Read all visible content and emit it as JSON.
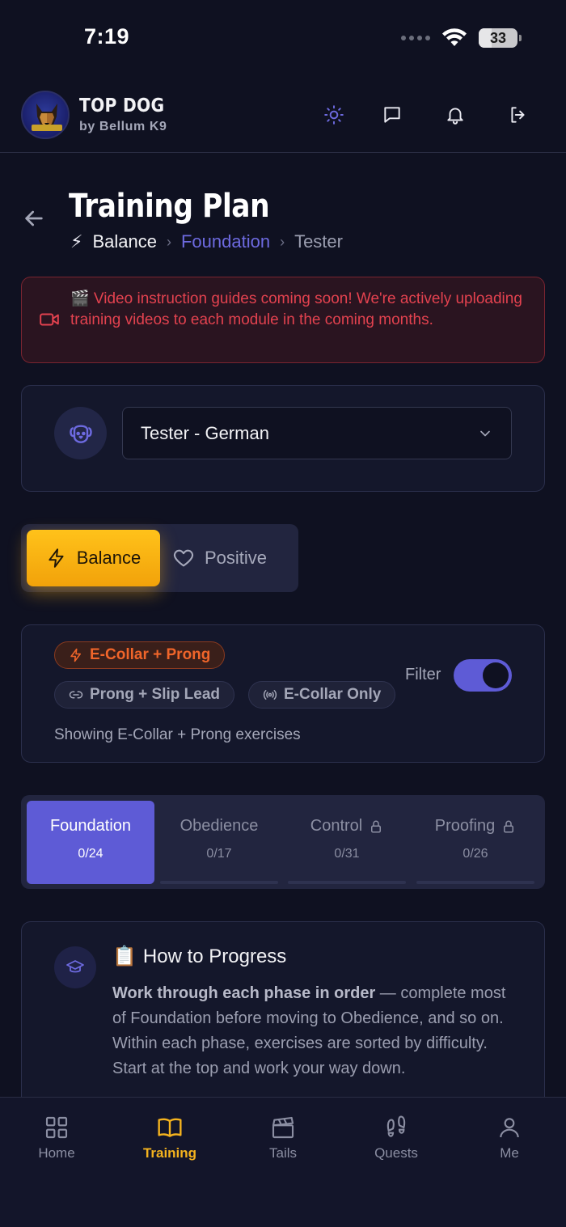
{
  "status_bar": {
    "time": "7:19",
    "battery": "33"
  },
  "header": {
    "brand_title": "TOP DOG",
    "brand_subtitle": "by Bellum K9",
    "icons": [
      "sun-icon",
      "chat-icon",
      "bell-icon",
      "logout-icon"
    ]
  },
  "page": {
    "title": "Training Plan",
    "breadcrumb": {
      "icon": "⚡",
      "method": "Balance",
      "phase": "Foundation",
      "dog": "Tester"
    }
  },
  "banner": {
    "text": "🎬 Video instruction guides coming soon! We're actively uploading training videos to each module in the coming months."
  },
  "dog_select": {
    "value": "Tester - German"
  },
  "method_toggle": {
    "options": [
      {
        "label": "Balance",
        "icon": "bolt-icon",
        "selected": true
      },
      {
        "label": "Positive",
        "icon": "heart-icon",
        "selected": false
      }
    ]
  },
  "equipment": {
    "chips": [
      {
        "label": "E-Collar + Prong",
        "icon": "bolt-icon",
        "active": true
      },
      {
        "label": "Prong + Slip Lead",
        "icon": "link-icon",
        "active": false
      },
      {
        "label": "E-Collar Only",
        "icon": "signal-icon",
        "active": false
      }
    ],
    "filter_label": "Filter",
    "filter_on": true,
    "note": "Showing E-Collar + Prong exercises"
  },
  "phases": [
    {
      "name": "Foundation",
      "count": "0/24",
      "locked": false,
      "active": true
    },
    {
      "name": "Obedience",
      "count": "0/17",
      "locked": false,
      "active": false
    },
    {
      "name": "Control",
      "count": "0/31",
      "locked": true,
      "active": false
    },
    {
      "name": "Proofing",
      "count": "0/26",
      "locked": true,
      "active": false
    }
  ],
  "progress_card": {
    "title_emoji": "📋",
    "title": "How to Progress",
    "body_bold": "Work through each phase in order",
    "body_rest": " — complete most of Foundation before moving to Obedience, and so on. Within each phase, exercises are sorted by difficulty. Start at the top and work your way down."
  },
  "nav": {
    "items": [
      {
        "label": "Home",
        "icon": "grid-icon"
      },
      {
        "label": "Training",
        "icon": "book-icon",
        "active": true
      },
      {
        "label": "Tails",
        "icon": "clapper-icon"
      },
      {
        "label": "Quests",
        "icon": "footprints-icon"
      },
      {
        "label": "Me",
        "icon": "person-icon"
      }
    ]
  },
  "colors": {
    "accent": "#5e5bd6",
    "balance": "#f5b31e",
    "danger": "#e3424f",
    "chip_active": "#f0652a"
  }
}
